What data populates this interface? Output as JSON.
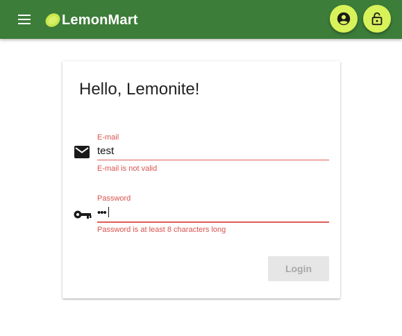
{
  "toolbar": {
    "brand": "LemonMart",
    "menu_icon": "menu-icon",
    "logo_icon": "lemon-icon",
    "profile_icon": "account-circle-icon",
    "lock_icon": "lock-open-icon"
  },
  "card": {
    "title": "Hello, Lemonite!"
  },
  "email": {
    "icon": "mail-icon",
    "label": "E-mail",
    "value": "test",
    "error": "E-mail is not valid"
  },
  "password": {
    "icon": "key-icon",
    "label": "Password",
    "value": "•••",
    "error": "Password is at least 8 characters long"
  },
  "login": {
    "label": "Login",
    "disabled": true
  },
  "colors": {
    "toolbar": "#3d7d3a",
    "accent": "#d8f25a",
    "error": "#d9534f"
  }
}
